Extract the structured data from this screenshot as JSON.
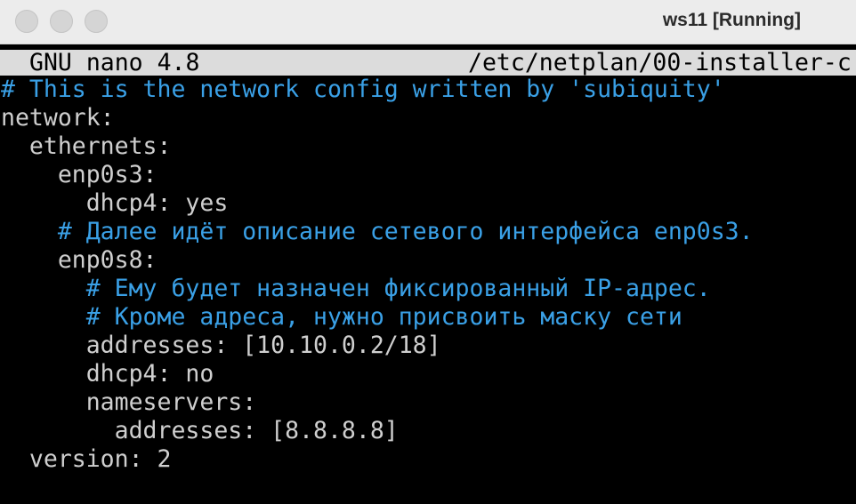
{
  "window": {
    "title": "ws11 [Running]"
  },
  "nano": {
    "version": "GNU nano 4.8",
    "filename": "/etc/netplan/00-installer-c"
  },
  "lines": [
    "# This is the network config written by 'subiquity'",
    "network:",
    "  ethernets:",
    "    enp0s3:",
    "      dhcp4: yes",
    "    # Далее идёт описание сетевого интерфейса enp0s3.",
    "    enp0s8:",
    "      # Ему будет назначен фиксированный IP-адрес.",
    "      # Кроме адреса, нужно присвоить маску сети",
    "      addresses: [10.10.0.2/18]",
    "      dhcp4: no",
    "      nameservers:",
    "        addresses: [8.8.8.8]",
    "  version: 2"
  ],
  "colors": {
    "comment": "#3aa0e6",
    "code": "#cfcfcf",
    "header_bg": "#dcdcdc",
    "background": "#000000"
  }
}
